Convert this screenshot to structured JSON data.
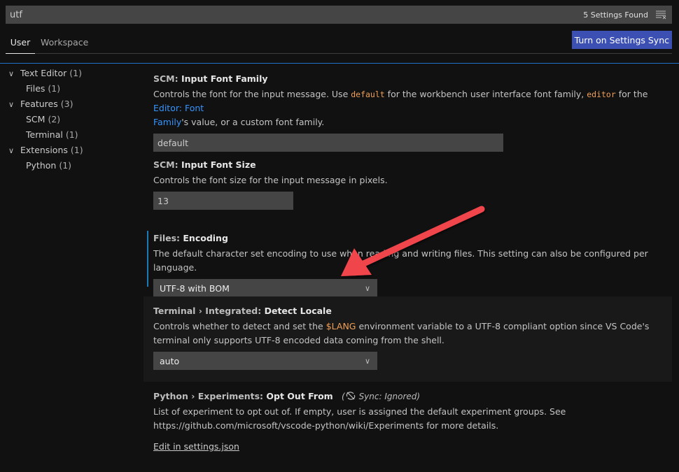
{
  "search": {
    "value": "utf",
    "results_count": "5 Settings Found",
    "clear_icon": "clear-filter-icon"
  },
  "tabs": [
    {
      "label": "User",
      "active": true
    },
    {
      "label": "Workspace",
      "active": false
    }
  ],
  "sync_button_label": "Turn on Settings Sync",
  "toc": [
    {
      "label": "Text Editor",
      "count": "(1)",
      "level": 0,
      "expanded": true
    },
    {
      "label": "Files",
      "count": "(1)",
      "level": 1
    },
    {
      "label": "Features",
      "count": "(3)",
      "level": 0,
      "expanded": true
    },
    {
      "label": "SCM",
      "count": "(2)",
      "level": 1
    },
    {
      "label": "Terminal",
      "count": "(1)",
      "level": 1
    },
    {
      "label": "Extensions",
      "count": "(1)",
      "level": 0,
      "expanded": true
    },
    {
      "label": "Python",
      "count": "(1)",
      "level": 1
    }
  ],
  "settings": {
    "scm_font_family": {
      "category": "SCM: ",
      "name": "Input Font Family",
      "desc_1": "Controls the font for the input message. Use ",
      "code_1": "default",
      "desc_2": " for the workbench user interface font family, ",
      "code_2": "editor",
      "desc_3": " for the ",
      "link_1": "Editor: Font",
      "link_2": "Family",
      "desc_4": "'s value, or a custom font family.",
      "value": "default"
    },
    "scm_font_size": {
      "category": "SCM: ",
      "name": "Input Font Size",
      "desc": "Controls the font size for the input message in pixels.",
      "value": "13"
    },
    "files_encoding": {
      "category": "Files: ",
      "name": "Encoding",
      "desc": "The default character set encoding to use when reading and writing files. This setting can also be configured per language.",
      "value": "UTF-8 with BOM",
      "modified": true
    },
    "terminal_locale": {
      "category": "Terminal › Integrated: ",
      "name": "Detect Locale",
      "desc_1": "Controls whether to detect and set the ",
      "code": "$LANG",
      "desc_2": " environment variable to a UTF-8 compliant option since VS Code's terminal only supports UTF-8 encoded data coming from the shell.",
      "value": "auto"
    },
    "python_opt_out": {
      "category": "Python › Experiments: ",
      "name": "Opt Out From",
      "sync_note": "Sync: Ignored",
      "desc_1": "List of experiment to opt out of. If empty, user is assigned the default experiment groups. See",
      "desc_2": "https://github.com/microsoft/vscode-python/wiki/Experiments for more details.",
      "edit_link": "Edit in settings.json"
    }
  },
  "annotation": {
    "color": "#f0444c"
  }
}
